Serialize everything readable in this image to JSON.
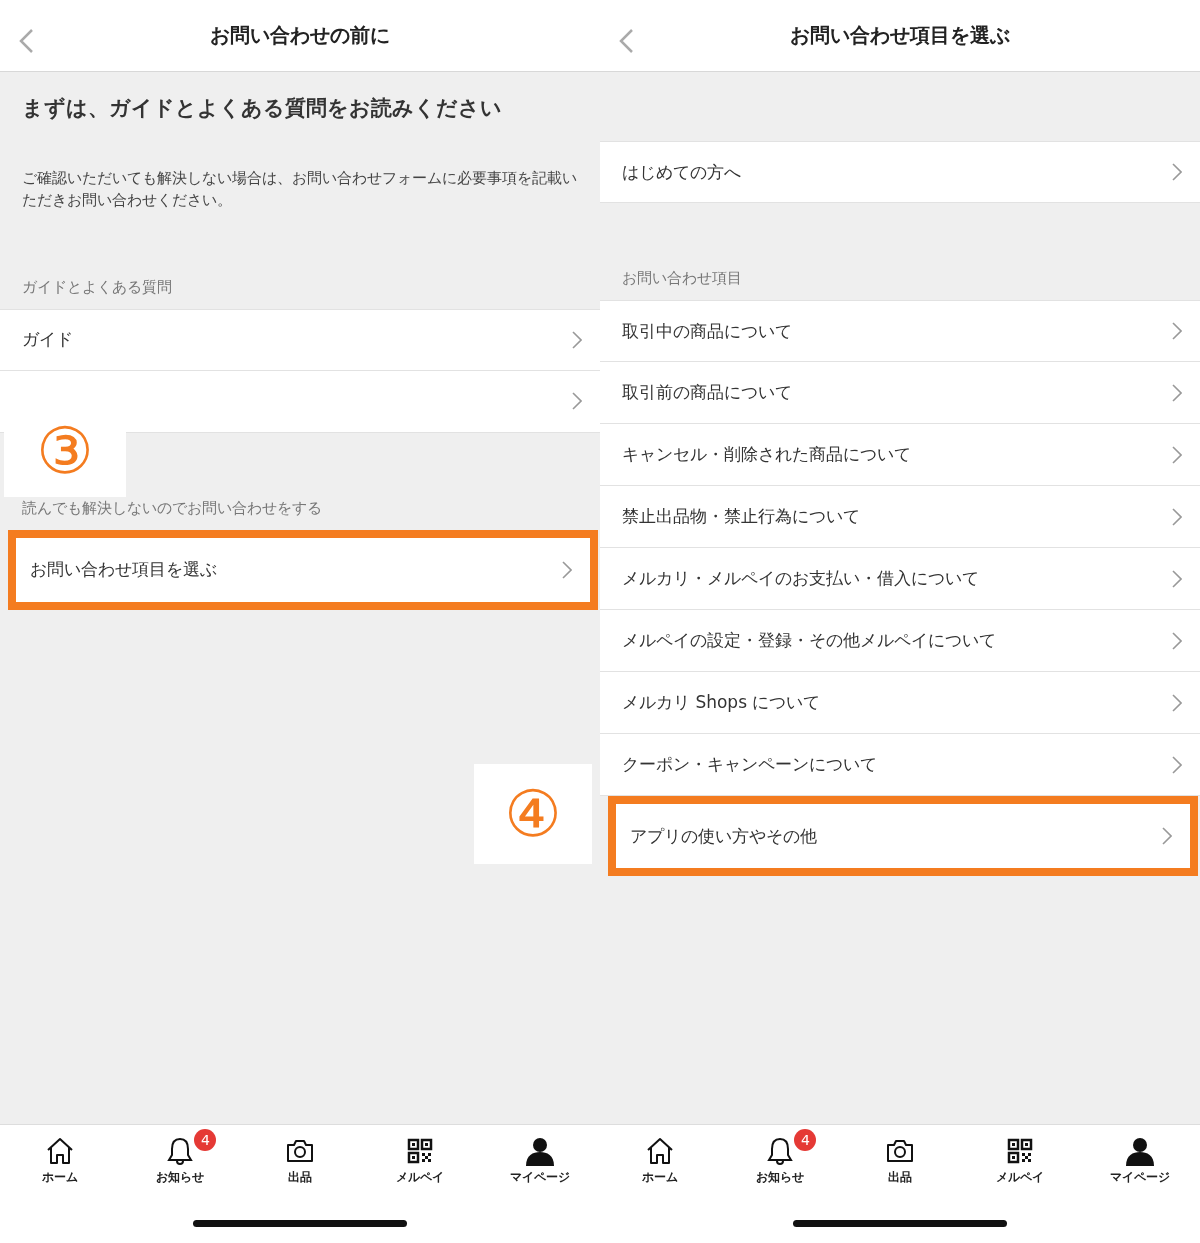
{
  "screens": [
    {
      "title": "お問い合わせの前に",
      "intro": {
        "heading": "まずは、ガイドとよくある質問をお読みください",
        "text": "ご確認いただいても解決しない場合は、お問い合わせフォームに必要事項を記載いただきお問い合わせください。"
      },
      "sections": [
        {
          "label": "ガイドとよくある質問",
          "items": [
            {
              "label": "ガイド",
              "highlighted": false
            },
            {
              "highlighted": false
            }
          ]
        },
        {
          "label": "読んでも解決しないのでお問い合わせをする",
          "items": [
            {
              "label": "お問い合わせ項目を選ぶ",
              "highlighted": true
            }
          ]
        }
      ],
      "tabbar": [
        {
          "kind": "home",
          "label": "ホーム"
        },
        {
          "kind": "bell",
          "label": "お知らせ",
          "badge": "4"
        },
        {
          "kind": "camera",
          "label": "出品"
        },
        {
          "kind": "qr",
          "label": "メルペイ"
        },
        {
          "kind": "person",
          "label": "マイページ"
        }
      ]
    },
    {
      "title": "お問い合わせ項目を選ぶ",
      "sections": [
        {
          "items": [
            {
              "label": "はじめての方へ",
              "highlighted": false
            }
          ]
        },
        {
          "label": "お問い合わせ項目",
          "items": [
            {
              "label": "取引中の商品について",
              "highlighted": false
            },
            {
              "label": "取引前の商品について",
              "highlighted": false
            },
            {
              "label": "キャンセル・削除された商品について",
              "highlighted": false
            },
            {
              "label": "禁止出品物・禁止行為について",
              "highlighted": false
            },
            {
              "label": "メルカリ・メルペイのお支払い・借入について",
              "highlighted": false
            },
            {
              "label": "メルペイの設定・登録・その他メルペイについて",
              "highlighted": false
            },
            {
              "label": "メルカリ Shops について",
              "highlighted": false
            },
            {
              "label": "クーポン・キャンペーンについて",
              "highlighted": false
            },
            {
              "label": "アプリの使い方やその他",
              "highlighted": true
            }
          ]
        }
      ],
      "tabbar": [
        {
          "kind": "home",
          "label": "ホーム"
        },
        {
          "kind": "bell",
          "label": "お知らせ",
          "badge": "4"
        },
        {
          "kind": "camera",
          "label": "出品"
        },
        {
          "kind": "qr",
          "label": "メルペイ"
        },
        {
          "kind": "person",
          "label": "マイページ"
        }
      ]
    }
  ],
  "annotations": [
    {
      "label": "③"
    },
    {
      "label": "④"
    }
  ]
}
